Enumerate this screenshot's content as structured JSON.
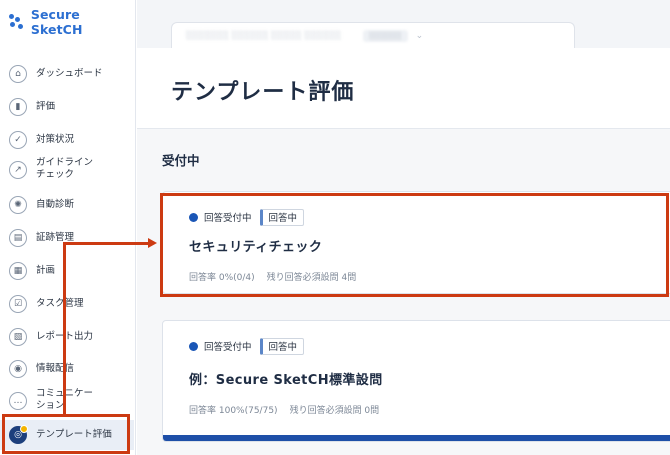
{
  "app": {
    "logo_text": "Secure SketCH"
  },
  "sidebar": {
    "items": [
      {
        "label": "ダッシュボード",
        "icon": "dashboard-icon",
        "glyph": "⌂"
      },
      {
        "label": "評価",
        "icon": "evaluation-icon",
        "glyph": "▮"
      },
      {
        "label": "対策状況",
        "icon": "check-icon",
        "glyph": "✓"
      },
      {
        "label": "ガイドライン\nチェック",
        "icon": "guideline-icon",
        "glyph": "↗"
      },
      {
        "label": "自動診断",
        "icon": "auto-diagnosis-icon",
        "glyph": "✺"
      },
      {
        "label": "証跡管理",
        "icon": "evidence-icon",
        "glyph": "▤"
      },
      {
        "label": "計画",
        "icon": "calendar-icon",
        "glyph": "▦"
      },
      {
        "label": "タスク管理",
        "icon": "task-icon",
        "glyph": "☑"
      },
      {
        "label": "レポート出力",
        "icon": "report-icon",
        "glyph": "▧"
      },
      {
        "label": "情報配信",
        "icon": "broadcast-icon",
        "glyph": "◉"
      },
      {
        "label": "コミュニケー\nション",
        "icon": "chat-icon",
        "glyph": "…"
      },
      {
        "label": "テンプレート評価",
        "icon": "template-evaluation-icon",
        "glyph": "◎",
        "active": true
      }
    ]
  },
  "page": {
    "title": "テンプレート評価"
  },
  "section": {
    "title": "受付中"
  },
  "cards": [
    {
      "status": "回答受付中",
      "badge": "回答中",
      "title": "セキュリティチェック",
      "rate": "回答率 0%(0/4)",
      "remaining": "残り回答必須設問 4問",
      "progress": 0
    },
    {
      "status": "回答受付中",
      "badge": "回答中",
      "title": "例：Secure SketCH標準設問",
      "rate": "回答率 100%(75/75)",
      "remaining": "残り回答必須設問 0問",
      "progress": 1
    }
  ],
  "colors": {
    "accent": "#1a56b6",
    "highlight": "#cc3a12",
    "active_nav": "#1d3f7c"
  }
}
